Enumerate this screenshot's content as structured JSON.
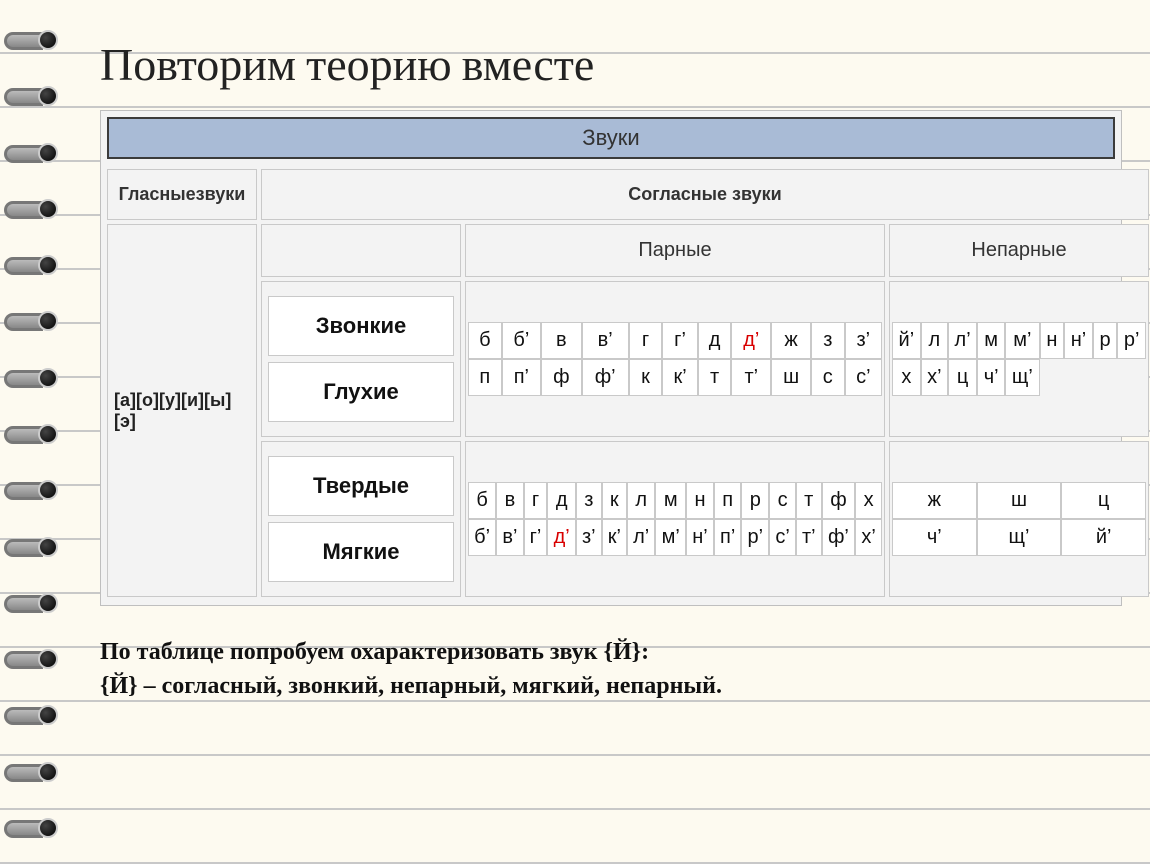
{
  "title": "Повторим теорию вместе",
  "banner": "Звуки",
  "headers": {
    "vowels": "Гласныезвуки",
    "consonants": "Согласные звуки",
    "paired": "Парные",
    "unpaired": "Непарные"
  },
  "vowels_value": "[а][о][у][и][ы][э]",
  "group1": {
    "labels": [
      "Звонкие",
      "Глухие"
    ],
    "paired_voiced": [
      "б",
      "б’",
      "в",
      "в’",
      "г",
      "г’",
      "д",
      "д’",
      "ж",
      "з",
      "з’"
    ],
    "paired_voiced_red_idx": 7,
    "paired_voiceless": [
      "п",
      "п’",
      "ф",
      "ф’",
      "к",
      "к’",
      "т",
      "т’",
      "ш",
      "с",
      "с’"
    ],
    "unpaired_voiced": [
      "й’",
      "л",
      "л’",
      "м",
      "м’",
      "н",
      "н’",
      "р",
      "р’"
    ],
    "unpaired_voiceless": [
      "х",
      "х’",
      "ц",
      "ч’",
      "щ’"
    ]
  },
  "group2": {
    "labels": [
      "Твердые",
      "Мягкие"
    ],
    "paired_hard": [
      "б",
      "в",
      "г",
      "д",
      "з",
      "к",
      "л",
      "м",
      "н",
      "п",
      "р",
      "с",
      "т",
      "ф",
      "х"
    ],
    "paired_soft": [
      "б’",
      "в’",
      "г’",
      "д’",
      "з’",
      "к’",
      "л’",
      "м’",
      "н’",
      "п’",
      "р’",
      "с’",
      "т’",
      "ф’",
      "х’"
    ],
    "paired_soft_red_idx": 3,
    "unpaired_hard": [
      "ж",
      "ш",
      "ц"
    ],
    "unpaired_soft": [
      "ч’",
      "щ’",
      "й’"
    ]
  },
  "footer": {
    "line1": "По таблице попробуем охарактеризовать звук  {Й}:",
    "line2": "{Й} – согласный, звонкий, непарный, мягкий, непарный."
  }
}
